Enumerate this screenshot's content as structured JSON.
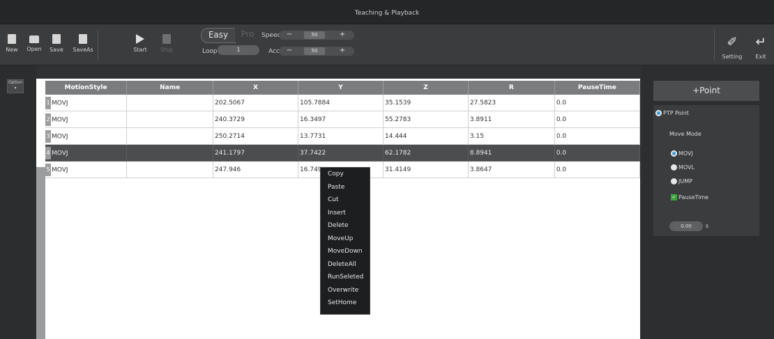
{
  "window": {
    "title": "Teaching & Playback"
  },
  "toolbar": {
    "new": "New",
    "open": "Open",
    "save": "Save",
    "saveas": "SaveAs",
    "start": "Start",
    "stop": "Stop",
    "easy": "Easy",
    "pro": "Pro",
    "loop_label": "Loop",
    "loop_value": "1",
    "speed_label": "Speed",
    "speed_value": "50",
    "acc_label": "Acc",
    "acc_value": "50",
    "minus": "−",
    "plus": "+",
    "setting": "Setting",
    "exit": "Exit"
  },
  "option": {
    "label": "Option ▾"
  },
  "table": {
    "columns": [
      "MotionStyle",
      "Name",
      "X",
      "Y",
      "Z",
      "R",
      "PauseTime"
    ],
    "rows": [
      {
        "n": "1",
        "style": "MOVJ",
        "name": "",
        "x": "202.5067",
        "y": "105.7884",
        "z": "35.1539",
        "r": "27.5823",
        "pause": "0.0"
      },
      {
        "n": "2",
        "style": "MOVJ",
        "name": "",
        "x": "240.3729",
        "y": "16.3497",
        "z": "55.2783",
        "r": "3.8911",
        "pause": "0.0"
      },
      {
        "n": "3",
        "style": "MOVJ",
        "name": "",
        "x": "250.2714",
        "y": "13.7731",
        "z": "14.444",
        "r": "3.15",
        "pause": "0.0"
      },
      {
        "n": "4",
        "style": "MOVJ",
        "name": "",
        "x": "241.1797",
        "y": "37.7422",
        "z": "62.1782",
        "r": "8.8941",
        "pause": "0.0"
      },
      {
        "n": "5",
        "style": "MOVJ",
        "name": "",
        "x": "247.946",
        "y": "16.749",
        "z": "31.4149",
        "r": "3.8647",
        "pause": "0.0"
      }
    ],
    "selected_row": 4
  },
  "context_menu": {
    "items": [
      "Copy",
      "Paste",
      "Cut",
      "Insert",
      "Delete",
      "MoveUp",
      "MoveDown",
      "DeleteAll",
      "RunSeleted",
      "Overwrite",
      "SetHome"
    ]
  },
  "right_panel": {
    "add_point": "+Point",
    "ptp_point": "PTP Point",
    "move_mode": "Move Mode",
    "modes": [
      "MOVJ",
      "MOVL",
      "JUMP"
    ],
    "pause_time": "PauseTime",
    "pause_value": "0.00",
    "unit": "s"
  }
}
